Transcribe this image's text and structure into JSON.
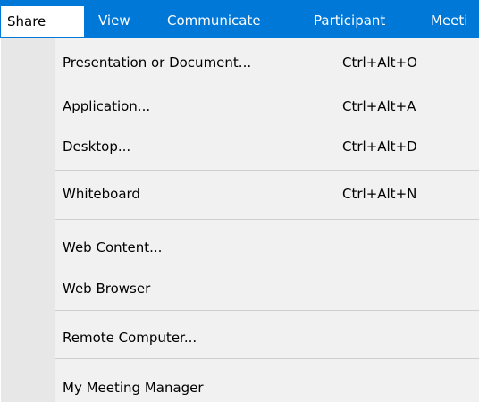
{
  "menu_bar": {
    "tabs": [
      {
        "label": "Share"
      },
      {
        "label": "View"
      },
      {
        "label": "Communicate"
      },
      {
        "label": "Participant"
      },
      {
        "label": "Meeti"
      }
    ]
  },
  "dropdown": {
    "items": [
      {
        "label": "Presentation or Document...",
        "shortcut": "Ctrl+Alt+O"
      },
      {
        "label": "Application...",
        "shortcut": "Ctrl+Alt+A"
      },
      {
        "label": "Desktop...",
        "shortcut": "Ctrl+Alt+D"
      },
      {
        "label": "Whiteboard",
        "shortcut": "Ctrl+Alt+N"
      },
      {
        "label": "Web Content...",
        "shortcut": ""
      },
      {
        "label": "Web Browser",
        "shortcut": ""
      },
      {
        "label": "Remote Computer...",
        "shortcut": ""
      },
      {
        "label": "My Meeting Manager",
        "shortcut": ""
      }
    ]
  },
  "colors": {
    "menu_bar_background": "#0078d7",
    "dropdown_background": "#f1f1f1",
    "gutter_background": "#e7e7e7",
    "separator": "#cfcfcf"
  }
}
